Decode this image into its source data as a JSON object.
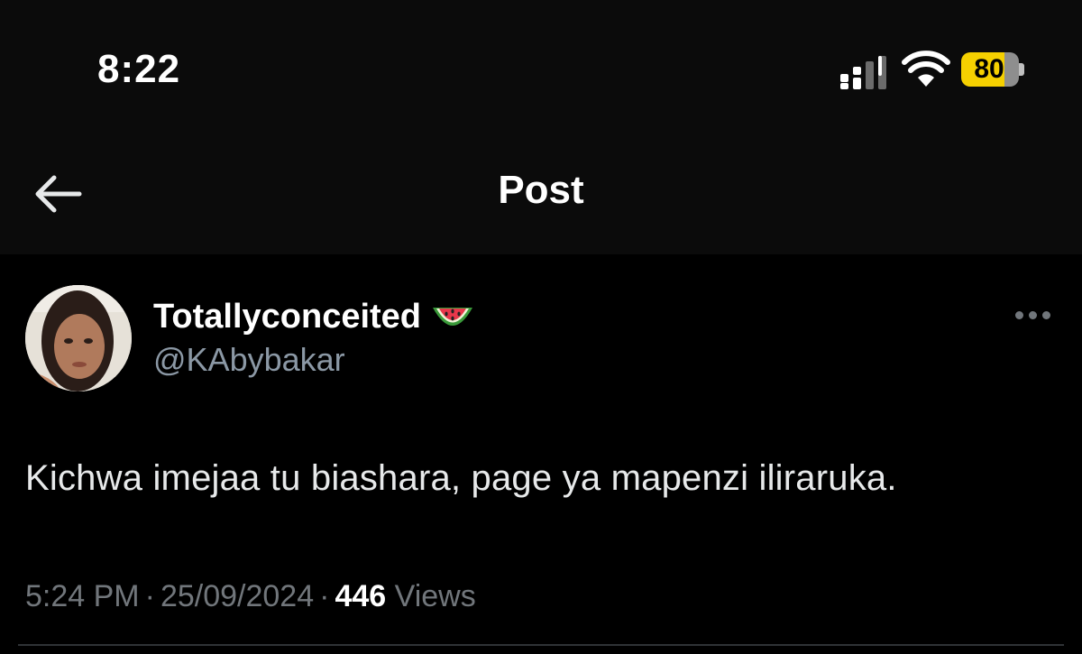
{
  "status_bar": {
    "time": "8:22",
    "battery_level": "80",
    "battery_color": "#f5d000"
  },
  "header": {
    "title": "Post",
    "back_icon": "arrow-left-icon"
  },
  "post": {
    "display_name": "Totallyconceited",
    "name_emoji_icon": "watermelon-icon",
    "handle": "@KAbybakar",
    "text": "Kichwa imejaa tu biashara, page ya mapenzi iliraruka.",
    "time": "5:24 PM",
    "separator": "·",
    "date": "25/09/2024",
    "views_count": "446",
    "views_label": "Views",
    "more_icon": "more-horizontal-icon"
  },
  "colors": {
    "background": "#000000",
    "text_primary": "#e7e9ea",
    "text_secondary": "#71767b"
  }
}
